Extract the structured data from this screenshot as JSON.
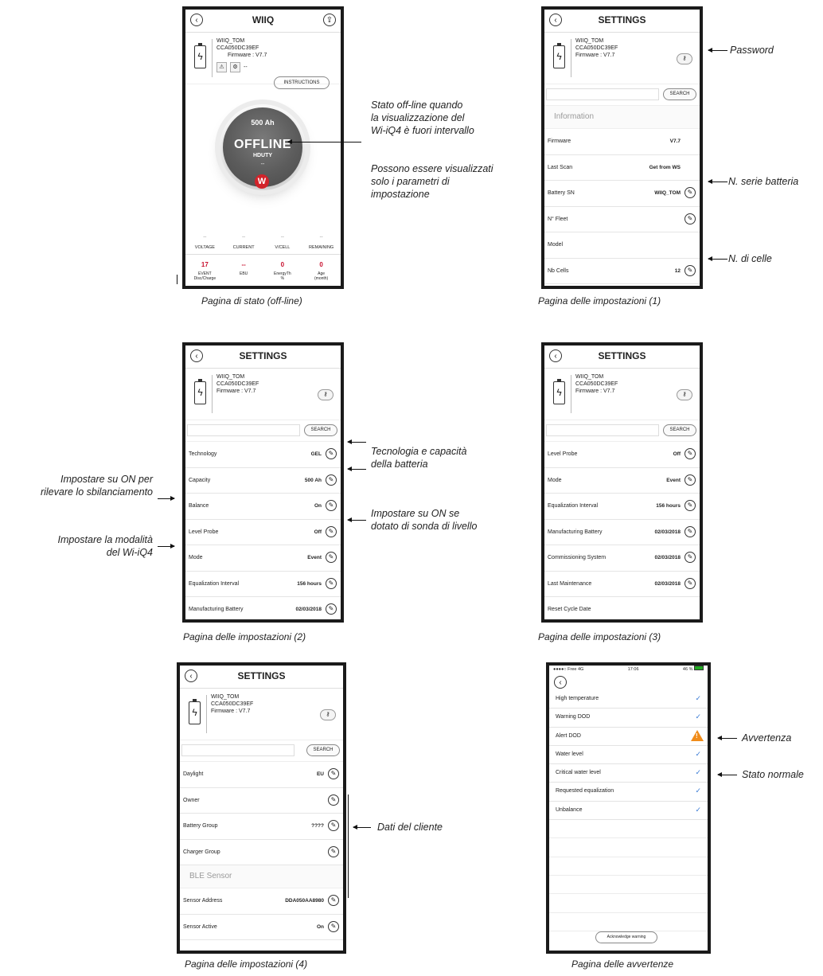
{
  "status_screen": {
    "title": "WIIQ",
    "device": {
      "name": "WIIQ_TOM",
      "serial": "CCA050DC39EF",
      "firmware": "Firmware : V7.7",
      "dash": "--"
    },
    "instructions_label": "INSTRUCTIONS",
    "gauge": {
      "capacity": "500 Ah",
      "state": "OFFLINE",
      "technology": "HDUTY",
      "sub": "--",
      "logo": "W"
    },
    "metrics": [
      {
        "value": "--",
        "label": "VOLTAGE"
      },
      {
        "value": "--",
        "label": "CURRENT"
      },
      {
        "value": "--",
        "label": "V/CELL"
      },
      {
        "value": "--",
        "label": "REMAINING"
      }
    ],
    "counters": [
      {
        "value": "17",
        "label": "EVENT",
        "sub": "Disc/Charge"
      },
      {
        "value": "--",
        "label": "EBU",
        "sub": ""
      },
      {
        "value": "0",
        "label": "EnergyTh",
        "sub": "%"
      },
      {
        "value": "0",
        "label": "Age",
        "sub": "(month)"
      }
    ],
    "caption": "Pagina di stato (off-line)"
  },
  "status_notes": {
    "offline_note": "Stato off-line quando\nla visualizzazione del\nWi-iQ4 è fuori intervallo",
    "params_note": "Possono essere visualizzati\nsolo i parametri di\nimpostazione"
  },
  "settings_common": {
    "title": "SETTINGS",
    "device_name": "WIIQ_TOM",
    "serial": "CCA050DC39EF",
    "firmware": "Firmware : V7.7",
    "search_label": "SEARCH"
  },
  "settings1": {
    "section": "Information",
    "rows": [
      {
        "label": "Firmware",
        "value": "V7.7"
      },
      {
        "label": "Last Scan",
        "value": "Get from WS"
      },
      {
        "label": "Battery SN",
        "value": "WIIQ_TOM"
      },
      {
        "label": "N° Fleet",
        "value": ""
      },
      {
        "label": "Model",
        "value": ""
      },
      {
        "label": "Nb Cells",
        "value": "12"
      }
    ],
    "caption": "Pagina delle impostazioni (1)",
    "notes": {
      "password": "Password",
      "serial": "N. serie batteria",
      "cells": "N. di celle"
    }
  },
  "settings2": {
    "rows": [
      {
        "label": "Technology",
        "value": "GEL"
      },
      {
        "label": "Capacity",
        "value": "500 Ah"
      },
      {
        "label": "Balance",
        "value": "On"
      },
      {
        "label": "Level Probe",
        "value": "Off"
      },
      {
        "label": "Mode",
        "value": "Event"
      },
      {
        "label": "Equalization Interval",
        "value": "156 hours"
      },
      {
        "label": "Manufacturing Battery",
        "value": "02/03/2018"
      }
    ],
    "caption": "Pagina delle impostazioni (2)",
    "notes": {
      "tech": "Tecnologia e capacità\ndella batteria",
      "balance": "Impostare su ON per\nrilevare lo sbilanciamento",
      "probe": "Impostare su ON se\ndotato di sonda di livello",
      "mode": "Impostare la modalità\ndel Wi-iQ4"
    }
  },
  "settings3": {
    "rows": [
      {
        "label": "Level Probe",
        "value": "Off"
      },
      {
        "label": "Mode",
        "value": "Event"
      },
      {
        "label": "Equalization Interval",
        "value": "156 hours"
      },
      {
        "label": "Manufacturing Battery",
        "value": "02/03/2018"
      },
      {
        "label": "Commissioning System",
        "value": "02/03/2018"
      },
      {
        "label": "Last Maintenance",
        "value": "02/03/2018"
      },
      {
        "label": "Reset Cycle Date",
        "value": ""
      }
    ],
    "caption": "Pagina delle impostazioni (3)"
  },
  "settings4": {
    "rows_a": [
      {
        "label": "Daylight",
        "value": "EU"
      },
      {
        "label": "Owner",
        "value": ""
      },
      {
        "label": "Battery Group",
        "value": "????"
      },
      {
        "label": "Charger Group",
        "value": ""
      }
    ],
    "section": "BLE Sensor",
    "rows_b": [
      {
        "label": "Sensor Address",
        "value": "DDA050AA8980"
      },
      {
        "label": "Sensor Active",
        "value": "On"
      }
    ],
    "caption": "Pagina delle impostazioni (4)",
    "notes": {
      "customer": "Dati del cliente"
    }
  },
  "warnings": {
    "statusbar": {
      "carrier": "●●●●○ Free  4G",
      "time": "17:06",
      "battery": "46 %"
    },
    "rows": [
      {
        "label": "High temperature",
        "state": "ok"
      },
      {
        "label": "Warning DOD",
        "state": "ok"
      },
      {
        "label": "Alert DOD",
        "state": "warning"
      },
      {
        "label": "Water level",
        "state": "ok"
      },
      {
        "label": "Critical water level",
        "state": "ok"
      },
      {
        "label": "Requested equalization",
        "state": "ok"
      },
      {
        "label": "Unbalance",
        "state": "ok"
      }
    ],
    "ack_label": "Acknowledge warning",
    "caption": "Pagina delle avvertenze",
    "notes": {
      "warning": "Avvertenza",
      "normal": "Stato normale"
    },
    "colors": {
      "check": "#3a7bd5",
      "warning": "#f08c1a"
    }
  }
}
